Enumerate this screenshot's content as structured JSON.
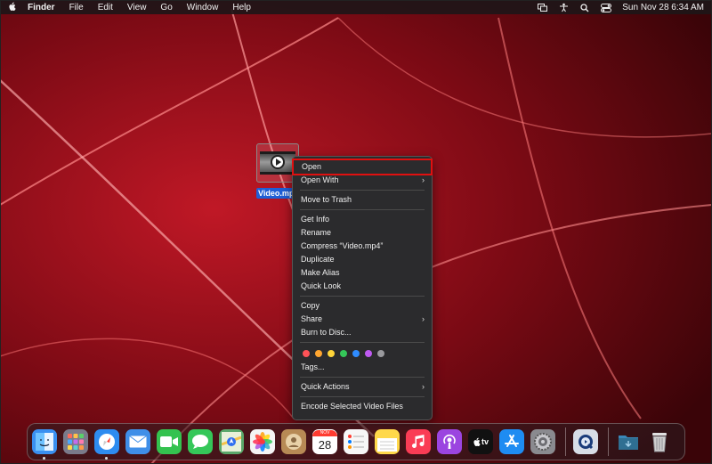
{
  "menubar": {
    "apple_icon": "apple-logo-icon",
    "app_name": "Finder",
    "menus": [
      "File",
      "Edit",
      "View",
      "Go",
      "Window",
      "Help"
    ],
    "status_icons": [
      "screen-mirroring-icon",
      "accessibility-icon",
      "search-icon",
      "control-center-icon"
    ],
    "clock": "Sun Nov 28  6:34 AM"
  },
  "desktop": {
    "file_label": "Video.mp4"
  },
  "context_menu": {
    "groups": [
      [
        {
          "label": "Open",
          "highlighted": true
        },
        {
          "label": "Open With",
          "submenu": true
        }
      ],
      [
        {
          "label": "Move to Trash"
        }
      ],
      [
        {
          "label": "Get Info"
        },
        {
          "label": "Rename"
        },
        {
          "label": "Compress “Video.mp4”"
        },
        {
          "label": "Duplicate"
        },
        {
          "label": "Make Alias"
        },
        {
          "label": "Quick Look"
        }
      ],
      [
        {
          "label": "Copy"
        },
        {
          "label": "Share",
          "submenu": true
        },
        {
          "label": "Burn to Disc..."
        }
      ],
      [
        {
          "label": "Tags..."
        }
      ],
      [
        {
          "label": "Quick Actions",
          "submenu": true
        }
      ],
      [
        {
          "label": "Encode Selected Video Files"
        }
      ]
    ],
    "tag_colors": [
      "#ff5257",
      "#ffa630",
      "#ffd53a",
      "#35c759",
      "#2f8cff",
      "#bf5af2",
      "#9a9a9e"
    ]
  },
  "dock": {
    "calendar_month": "NOV",
    "calendar_day": "28",
    "tv_label": "tv",
    "apps": [
      {
        "name": "finder-icon",
        "color": "#3a8ff0",
        "running": true
      },
      {
        "name": "launchpad-icon",
        "color": "#7a7a8a",
        "running": false
      },
      {
        "name": "safari-icon",
        "color": "#2e8cf0",
        "running": true
      },
      {
        "name": "mail-icon",
        "color": "#3f8fe8",
        "running": false
      },
      {
        "name": "facetime-icon",
        "color": "#34c24f",
        "running": false
      },
      {
        "name": "messages-icon",
        "color": "#35c759",
        "running": false
      },
      {
        "name": "maps-icon",
        "color": "#5aa86a",
        "running": false
      },
      {
        "name": "photos-icon",
        "color": "#f4f4f4",
        "running": false
      },
      {
        "name": "contacts-icon",
        "color": "#b78a55",
        "running": false
      },
      {
        "name": "calendar-icon",
        "color": "#ffffff",
        "running": false
      },
      {
        "name": "reminders-icon",
        "color": "#f7f7f7",
        "running": false
      },
      {
        "name": "notes-icon",
        "color": "#ffd84a",
        "running": false
      },
      {
        "name": "music-icon",
        "color": "#fa3c55",
        "running": false
      },
      {
        "name": "podcasts-icon",
        "color": "#9b45e0",
        "running": false
      },
      {
        "name": "apple-tv-icon",
        "color": "#111111",
        "running": false
      },
      {
        "name": "app-store-icon",
        "color": "#1e8cf2",
        "running": false
      },
      {
        "name": "system-preferences-icon",
        "color": "#8a8a8f",
        "running": false
      },
      {
        "name": "quicktime-icon",
        "color": "#d7dde6",
        "running": false
      }
    ],
    "trailing": [
      {
        "name": "downloads-folder-icon",
        "color": "#2f6f92"
      },
      {
        "name": "trash-icon",
        "color": "#bcbcbc"
      }
    ]
  }
}
